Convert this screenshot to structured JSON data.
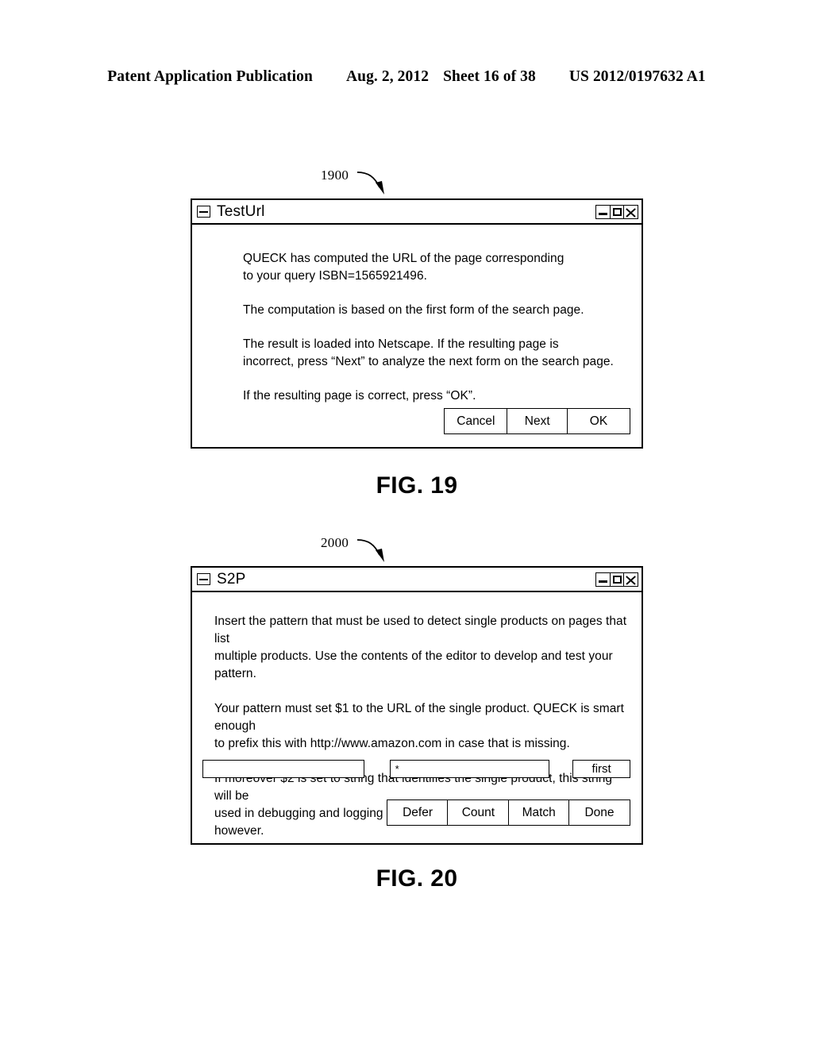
{
  "header": {
    "publication": "Patent Application Publication",
    "date": "Aug. 2, 2012",
    "sheet": "Sheet 16 of 38",
    "number": "US 2012/0197632 A1"
  },
  "figure19": {
    "callout": "1900",
    "caption": "FIG. 19",
    "window": {
      "title": "TestUrl",
      "sysmenu_icon": "minimize-box-icon",
      "controls": [
        {
          "name": "minimize-button",
          "icon": "minimize-icon"
        },
        {
          "name": "maximize-button",
          "icon": "maximize-icon"
        },
        {
          "name": "close-button",
          "icon": "close-icon"
        }
      ],
      "paragraphs": [
        "QUECK has computed the URL of the page corresponding\nto your query ISBN=1565921496.",
        "The computation is based on the first form of the search page.",
        "The result is loaded into Netscape. If the resulting page is\nincorrect, press “Next” to analyze the next form on the search page.",
        "If the resulting page is correct, press “OK”."
      ],
      "buttons": [
        {
          "label": "Cancel"
        },
        {
          "label": "Next"
        },
        {
          "label": "OK"
        }
      ]
    }
  },
  "figure20": {
    "callout": "2000",
    "caption": "FIG. 20",
    "window": {
      "title": "S2P",
      "sysmenu_icon": "minimize-box-icon",
      "controls": [
        {
          "name": "minimize-button",
          "icon": "minimize-icon"
        },
        {
          "name": "maximize-button",
          "icon": "maximize-icon"
        },
        {
          "name": "close-button",
          "icon": "close-icon"
        }
      ],
      "paragraphs": [
        "Insert the pattern that must be used to detect single products on pages that list\nmultiple products. Use the contents of the editor to develop and test your pattern.",
        "Your pattern must set $1 to the URL of the single product. QUECK is smart enough\nto prefix this with http://www.amazon.com in case that is missing.",
        "If moreover $2 is set to string that identifies the single product, this string will be\nused in debugging and logging information. Setting $2 is not required however."
      ],
      "fields": {
        "pattern_value": "",
        "marker_value": "*",
        "first_value": "first"
      },
      "buttons": [
        {
          "label": "Defer"
        },
        {
          "label": "Count"
        },
        {
          "label": "Match"
        },
        {
          "label": "Done"
        }
      ]
    }
  },
  "colors": {
    "ink": "#000000",
    "paper": "#ffffff"
  }
}
